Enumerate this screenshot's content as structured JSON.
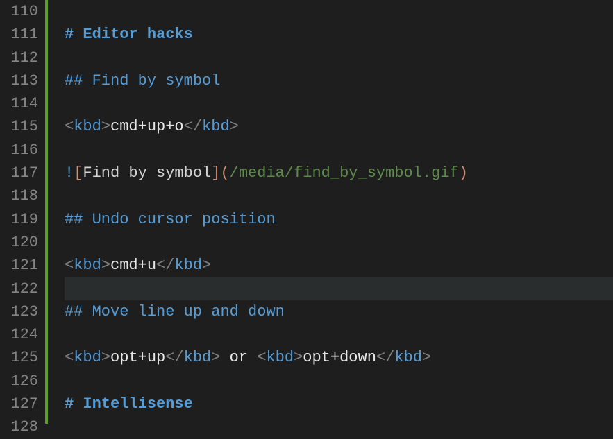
{
  "gutter": {
    "start": 110,
    "end": 128
  },
  "currentLine": 122,
  "lines": {
    "110": {
      "tokens": []
    },
    "111": {
      "tokens": [
        {
          "cls": "h",
          "t": "# "
        },
        {
          "cls": "h",
          "t": "Editor hacks"
        }
      ]
    },
    "112": {
      "tokens": []
    },
    "113": {
      "tokens": [
        {
          "cls": "hn",
          "t": "## "
        },
        {
          "cls": "hn",
          "t": "Find by symbol"
        }
      ]
    },
    "114": {
      "tokens": []
    },
    "115": {
      "tokens": [
        {
          "cls": "tag",
          "t": "<"
        },
        {
          "cls": "ename",
          "t": "kbd"
        },
        {
          "cls": "tag",
          "t": ">"
        },
        {
          "cls": "txt",
          "t": "cmd+up+o"
        },
        {
          "cls": "tag",
          "t": "</"
        },
        {
          "cls": "ename",
          "t": "kbd"
        },
        {
          "cls": "tag",
          "t": ">"
        }
      ]
    },
    "116": {
      "tokens": []
    },
    "117": {
      "tokens": [
        {
          "cls": "bang",
          "t": "!"
        },
        {
          "cls": "brk",
          "t": "["
        },
        {
          "cls": "alt",
          "t": "Find by symbol"
        },
        {
          "cls": "brk",
          "t": "]"
        },
        {
          "cls": "paren",
          "t": "("
        },
        {
          "cls": "url",
          "t": "/media/find_by_symbol.gif"
        },
        {
          "cls": "paren",
          "t": ")"
        }
      ]
    },
    "118": {
      "tokens": []
    },
    "119": {
      "tokens": [
        {
          "cls": "hn",
          "t": "## "
        },
        {
          "cls": "hn",
          "t": "Undo cursor position"
        }
      ]
    },
    "120": {
      "tokens": []
    },
    "121": {
      "tokens": [
        {
          "cls": "tag",
          "t": "<"
        },
        {
          "cls": "ename",
          "t": "kbd"
        },
        {
          "cls": "tag",
          "t": ">"
        },
        {
          "cls": "txt",
          "t": "cmd+u"
        },
        {
          "cls": "tag",
          "t": "</"
        },
        {
          "cls": "ename",
          "t": "kbd"
        },
        {
          "cls": "tag",
          "t": ">"
        }
      ]
    },
    "122": {
      "tokens": []
    },
    "123": {
      "tokens": [
        {
          "cls": "hn",
          "t": "## "
        },
        {
          "cls": "hn",
          "t": "Move line up and down"
        }
      ]
    },
    "124": {
      "tokens": []
    },
    "125": {
      "tokens": [
        {
          "cls": "tag",
          "t": "<"
        },
        {
          "cls": "ename",
          "t": "kbd"
        },
        {
          "cls": "tag",
          "t": ">"
        },
        {
          "cls": "txt",
          "t": "opt+up"
        },
        {
          "cls": "tag",
          "t": "</"
        },
        {
          "cls": "ename",
          "t": "kbd"
        },
        {
          "cls": "tag",
          "t": ">"
        },
        {
          "cls": "txt",
          "t": " or "
        },
        {
          "cls": "tag",
          "t": "<"
        },
        {
          "cls": "ename",
          "t": "kbd"
        },
        {
          "cls": "tag",
          "t": ">"
        },
        {
          "cls": "txt",
          "t": "opt+down"
        },
        {
          "cls": "tag",
          "t": "</"
        },
        {
          "cls": "ename",
          "t": "kbd"
        },
        {
          "cls": "tag",
          "t": ">"
        }
      ]
    },
    "126": {
      "tokens": []
    },
    "127": {
      "tokens": [
        {
          "cls": "h",
          "t": "# "
        },
        {
          "cls": "h",
          "t": "Intellisense"
        }
      ]
    },
    "128": {
      "tokens": []
    }
  }
}
